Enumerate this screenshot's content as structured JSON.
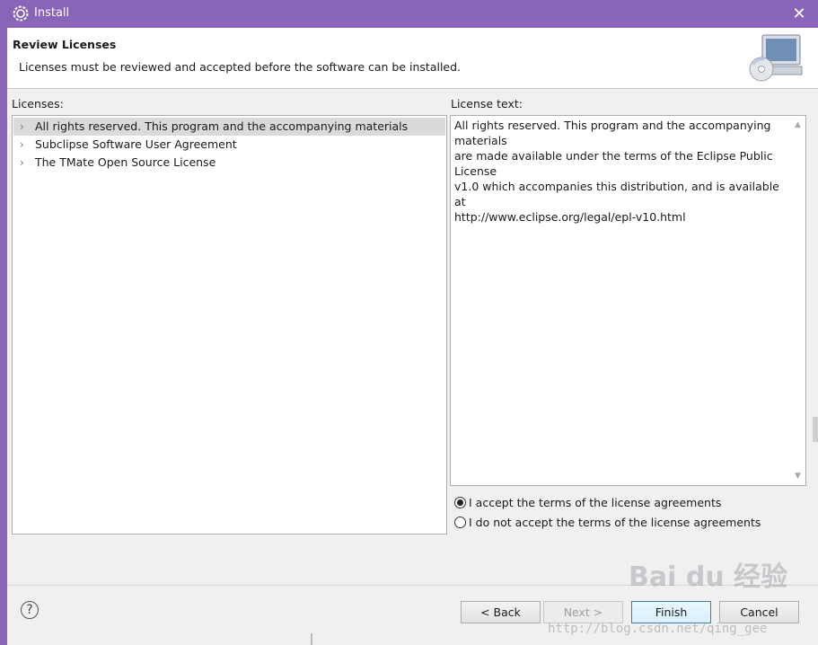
{
  "window": {
    "title": "Install"
  },
  "banner": {
    "heading": "Review Licenses",
    "description": "Licenses must be reviewed and accepted before the software can be installed."
  },
  "licenses": {
    "label": "Licenses:",
    "items": [
      {
        "label": "All rights reserved. This program and the accompanying materials",
        "selected": true
      },
      {
        "label": "Subclipse Software User Agreement",
        "selected": false
      },
      {
        "label": "The TMate Open Source License",
        "selected": false
      }
    ]
  },
  "license_text": {
    "label": "License text:",
    "content": "All rights reserved. This program and the accompanying\nmaterials\nare made available under the terms of the Eclipse Public\nLicense\nv1.0 which accompanies this distribution, and is available at\nhttp://www.eclipse.org/legal/epl-v10.html"
  },
  "agreement": {
    "accept_label": "I accept the terms of the license agreements",
    "decline_label": "I do not accept the terms of the license agreements",
    "selected": "accept"
  },
  "buttons": {
    "help": "?",
    "back": "< Back",
    "next": "Next >",
    "finish": "Finish",
    "cancel": "Cancel"
  },
  "watermark": {
    "brand": "Bai du 经验",
    "url": "http://blog.csdn.net/qing_gee"
  },
  "colors": {
    "titlebar": "#8a64b7",
    "selection": "#dadada",
    "default_button_border": "#3c7fb1"
  },
  "icons": {
    "window": "eclipse-gear-icon",
    "close": "close-icon",
    "banner": "install-cd-computer-icon",
    "tree_expand": "chevron-right-icon"
  }
}
